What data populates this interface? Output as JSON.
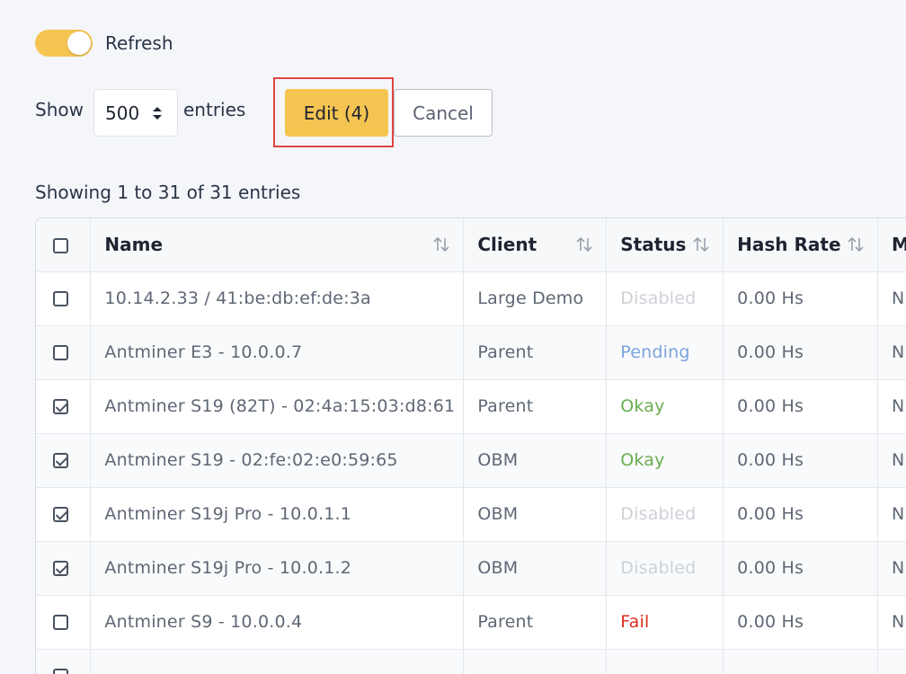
{
  "refresh": {
    "label": "Refresh",
    "enabled": true,
    "color": "#f5c451"
  },
  "length": {
    "show_label": "Show",
    "value": "500",
    "entries_label": "entries"
  },
  "actions": {
    "edit_label": "Edit (4)",
    "cancel_label": "Cancel"
  },
  "info": "Showing 1 to 31 of 31 entries",
  "table": {
    "columns": [
      "Name",
      "Client",
      "Status",
      "Hash Rate",
      "M"
    ],
    "rows": [
      {
        "checked": false,
        "name": "10.14.2.33 / 41:be:db:ef:de:3a",
        "client": "Large Demo",
        "status": "Disabled",
        "status_type": "disabled",
        "hash_rate": "0.00 Hs",
        "extra": "N"
      },
      {
        "checked": false,
        "name": "Antminer E3 - 10.0.0.7",
        "client": "Parent",
        "status": "Pending",
        "status_type": "pending",
        "hash_rate": "0.00 Hs",
        "extra": "N"
      },
      {
        "checked": true,
        "name": "Antminer S19 (82T) - 02:4a:15:03:d8:61",
        "client": "Parent",
        "status": "Okay",
        "status_type": "okay",
        "hash_rate": "0.00 Hs",
        "extra": "N"
      },
      {
        "checked": true,
        "name": "Antminer S19 - 02:fe:02:e0:59:65",
        "client": "OBM",
        "status": "Okay",
        "status_type": "okay",
        "hash_rate": "0.00 Hs",
        "extra": "N"
      },
      {
        "checked": true,
        "name": "Antminer S19j Pro - 10.0.1.1",
        "client": "OBM",
        "status": "Disabled",
        "status_type": "disabled",
        "hash_rate": "0.00 Hs",
        "extra": "N"
      },
      {
        "checked": true,
        "name": "Antminer S19j Pro - 10.0.1.2",
        "client": "OBM",
        "status": "Disabled",
        "status_type": "disabled",
        "hash_rate": "0.00 Hs",
        "extra": "N"
      },
      {
        "checked": false,
        "name": "Antminer S9 - 10.0.0.4",
        "client": "Parent",
        "status": "Fail",
        "status_type": "fail",
        "hash_rate": "0.00 Hs",
        "extra": "N"
      },
      {
        "checked": false,
        "name": "",
        "client": "",
        "status": "",
        "status_type": "fail",
        "hash_rate": "",
        "extra": ""
      }
    ]
  }
}
